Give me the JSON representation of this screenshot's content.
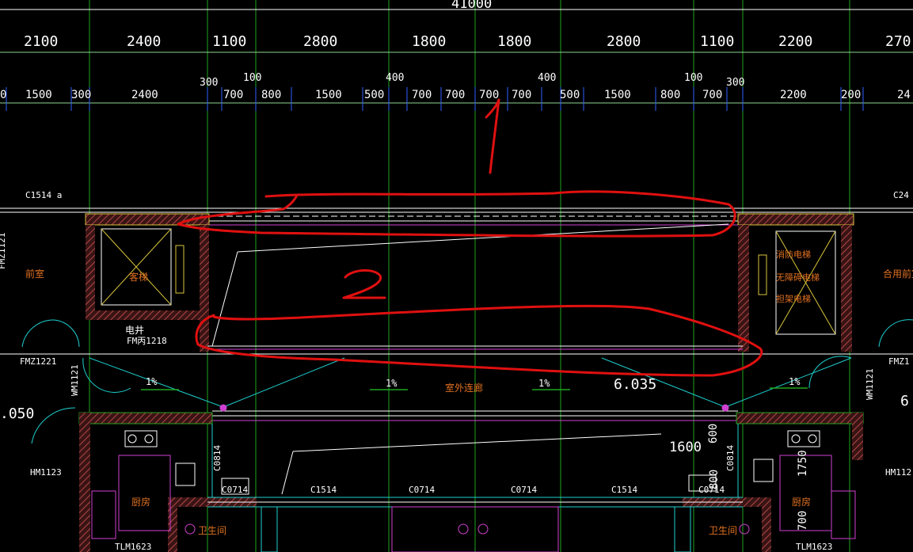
{
  "colors": {
    "background": "#000000",
    "grid_green": "#1fa51f",
    "dim_white": "#ffffff",
    "wall_hatch": "#8b3a3a",
    "wall_fill": "#5a2020",
    "yellow": "#d8c43a",
    "cyan": "#1fd0d0",
    "magenta": "#d040d0",
    "orange_text": "#e07020",
    "annotation_red": "#e01010",
    "blue_tick": "#3060ff"
  },
  "top_total": "41000",
  "dim_row1": [
    {
      "id": "d1a",
      "text": "2100"
    },
    {
      "id": "d1b",
      "text": "2400"
    },
    {
      "id": "d1c",
      "text": "1100"
    },
    {
      "id": "d1d",
      "text": "2800"
    },
    {
      "id": "d1e",
      "text": "1800"
    },
    {
      "id": "d1f",
      "text": "1800"
    },
    {
      "id": "d1g",
      "text": "2800"
    },
    {
      "id": "d1h",
      "text": "1100"
    },
    {
      "id": "d1i",
      "text": "2200"
    },
    {
      "id": "d1j",
      "text": "270"
    }
  ],
  "dim_row2_upper": [
    {
      "id": "u1",
      "text": "300"
    },
    {
      "id": "u2",
      "text": "100"
    },
    {
      "id": "u3",
      "text": "400"
    },
    {
      "id": "u4",
      "text": "400"
    },
    {
      "id": "u5",
      "text": "100"
    },
    {
      "id": "u6",
      "text": "300"
    }
  ],
  "dim_row2": [
    {
      "id": "d2a",
      "text": "0"
    },
    {
      "id": "d2b",
      "text": "1500"
    },
    {
      "id": "d2c",
      "text": "300"
    },
    {
      "id": "d2d",
      "text": "2400"
    },
    {
      "id": "d2e",
      "text": "700"
    },
    {
      "id": "d2f",
      "text": "800"
    },
    {
      "id": "d2g",
      "text": "1500"
    },
    {
      "id": "d2h",
      "text": "500"
    },
    {
      "id": "d2i",
      "text": "700"
    },
    {
      "id": "d2j",
      "text": "700"
    },
    {
      "id": "d2k",
      "text": "700"
    },
    {
      "id": "d2l",
      "text": "700"
    },
    {
      "id": "d2m",
      "text": "500"
    },
    {
      "id": "d2n",
      "text": "1500"
    },
    {
      "id": "d2o",
      "text": "800"
    },
    {
      "id": "d2p",
      "text": "700"
    },
    {
      "id": "d2q",
      "text": "2200"
    },
    {
      "id": "d2r",
      "text": "200"
    },
    {
      "id": "d2s",
      "text": "24"
    }
  ],
  "labels": {
    "window_left": "C1514 a",
    "window_right": "C24",
    "fmz_vertical": "FMZ1121",
    "front_room": "前室",
    "passenger_elevator": "客梯",
    "elec_shaft": "电井",
    "fm_door": "FM丙1218",
    "fmz_left": "FMZ1221",
    "fmz_right": "FMZ1",
    "fire_elevator": "消防电梯",
    "accessible_elevator": "无障碍电梯",
    "stretcher_elevator": "担架电梯",
    "shared_front_room": "合用前室",
    "wm_left": "WM1121",
    "wm_right": "WM1121",
    "slope_1": "1%",
    "slope_2": "1%",
    "slope_3": "1%",
    "slope_4": "1%",
    "outdoor_corridor": "室外连廊",
    "elevation_main": "6.035",
    "elevation_left": ".050",
    "elevation_right": "6",
    "hm_left": "HM1123",
    "hm_right": "HM112",
    "c0814_left": "C0814",
    "c0814_right": "C0814",
    "c0714_a": "C0714",
    "c1514_a": "C1514",
    "c0714_b": "C0714",
    "c0714_c": "C0714",
    "c1514_b": "C1514",
    "c0714_d": "C0714",
    "dim_1600": "1600",
    "dim_600": "600",
    "dim_800": "800",
    "dim_1750": "1750",
    "dim_700": "700",
    "kitchen_left": "厨房",
    "kitchen_right": "厨房",
    "bath_left": "卫生间",
    "bath_right": "卫生间",
    "tlm_left": "TLM1623",
    "tlm_right": "TLM1623"
  },
  "annotations": {
    "mark_1": "1",
    "mark_2": "2"
  }
}
